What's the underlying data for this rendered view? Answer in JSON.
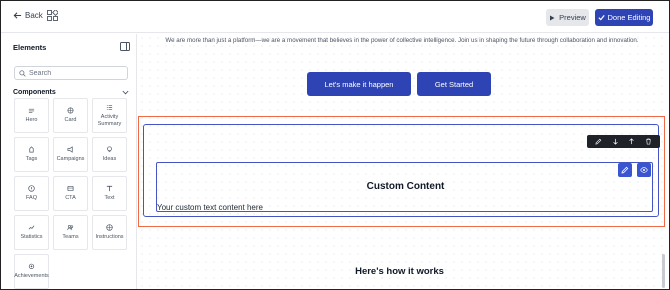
{
  "topbar": {
    "back_label": "Back",
    "preview_label": "Preview",
    "done_label": "Done Editing",
    "accent_color": "#2f44b4"
  },
  "sidebar": {
    "title": "Elements",
    "search_placeholder": "Search",
    "section_label": "Components",
    "tiles": [
      {
        "label": "Hero",
        "icon": "hero-icon"
      },
      {
        "label": "Card",
        "icon": "card-icon"
      },
      {
        "label": "Activity Summary",
        "icon": "activity-summary-icon"
      },
      {
        "label": "Tags",
        "icon": "tags-icon"
      },
      {
        "label": "Campaigns",
        "icon": "campaigns-icon"
      },
      {
        "label": "Ideas",
        "icon": "ideas-icon"
      },
      {
        "label": "FAQ",
        "icon": "faq-icon"
      },
      {
        "label": "CTA",
        "icon": "cta-icon"
      },
      {
        "label": "Text",
        "icon": "text-icon"
      },
      {
        "label": "Statistics",
        "icon": "statistics-icon"
      },
      {
        "label": "Teams",
        "icon": "teams-icon"
      },
      {
        "label": "Instructions",
        "icon": "instructions-icon"
      },
      {
        "label": "Achievements",
        "icon": "achievements-icon"
      }
    ]
  },
  "canvas": {
    "intro_text": "We are more than just a platform—we are a movement that believes in the power of collective intelligence. Join us in shaping the future through collaboration and innovation.",
    "cta_primary": "Let's make it happen",
    "cta_secondary": "Get Started",
    "selected_block": {
      "title": "Custom Content",
      "body": "Your custom text content here",
      "selection_color": "#ef6a47"
    },
    "next_heading": "Here's how it works"
  }
}
